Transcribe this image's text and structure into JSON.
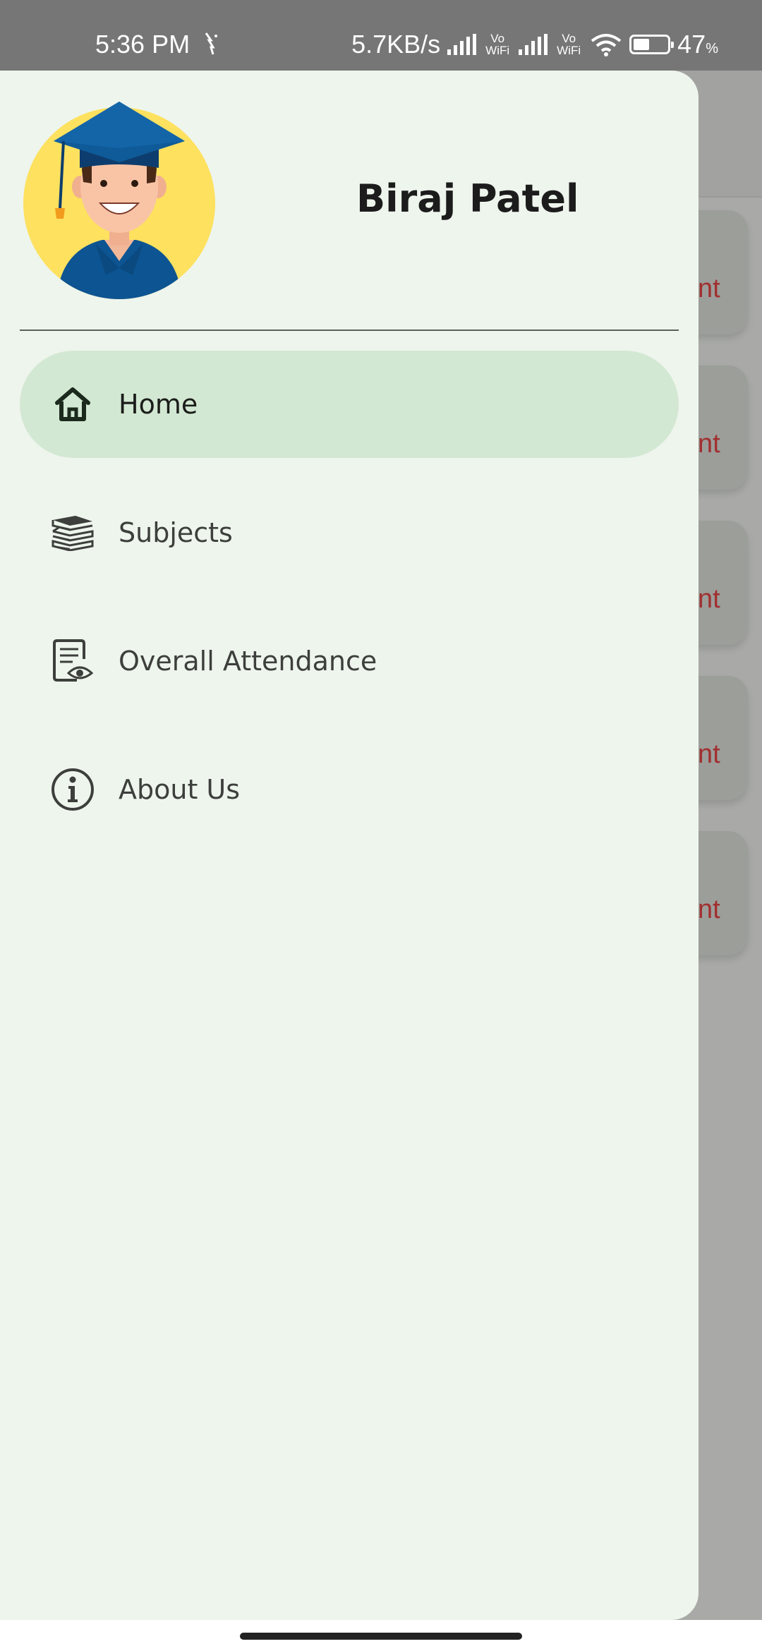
{
  "status_bar": {
    "time": "5:36 PM",
    "net_speed": "5.7KB/s",
    "vowifi_1": "Vo WiFi",
    "vowifi_2": "Vo WiFi",
    "battery_percent": "47",
    "battery_unit": "%"
  },
  "drawer": {
    "user_name": "Biraj Patel",
    "avatar_icon": "graduate-avatar-icon",
    "items": [
      {
        "label": "Home",
        "icon": "home-icon",
        "active": true
      },
      {
        "label": "Subjects",
        "icon": "books-icon",
        "active": false
      },
      {
        "label": "Overall Attendance",
        "icon": "attendance-report-icon",
        "active": false
      },
      {
        "label": "About Us",
        "icon": "info-icon",
        "active": false
      }
    ]
  },
  "background": {
    "cards_partial_text": [
      "nt",
      "nt",
      "nt",
      "nt",
      "nt"
    ],
    "partial_text_color": "#a13030"
  },
  "colors": {
    "drawer_bg": "#eef5ed",
    "active_item_bg": "#d3e8d3",
    "scrim": "#a9aaa7"
  }
}
